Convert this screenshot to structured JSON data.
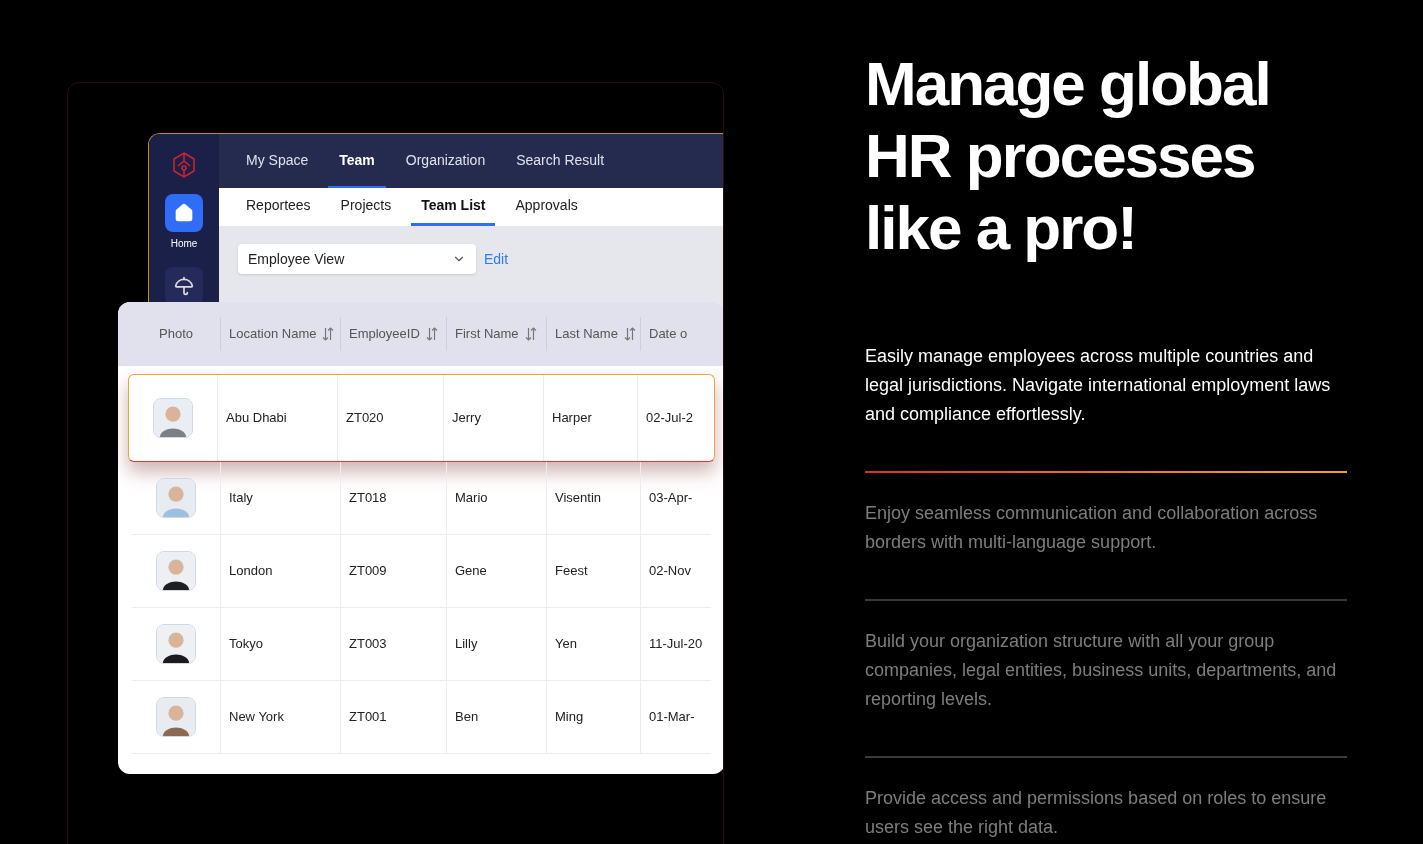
{
  "app": {
    "sidebar": {
      "items": [
        {
          "label": "Home",
          "selected": true
        },
        {
          "selected": false
        }
      ]
    },
    "top_tabs": [
      {
        "label": "My Space",
        "selected": false
      },
      {
        "label": "Team",
        "selected": true
      },
      {
        "label": "Organization",
        "selected": false
      },
      {
        "label": "Search Result",
        "selected": false
      }
    ],
    "sub_tabs": [
      {
        "label": "Reportees",
        "selected": false
      },
      {
        "label": "Projects",
        "selected": false
      },
      {
        "label": "Team List",
        "selected": true
      },
      {
        "label": "Approvals",
        "selected": false
      }
    ],
    "view_select": {
      "value": "Employee View"
    },
    "edit_link": "Edit",
    "table": {
      "photo_column": "Photo",
      "columns": [
        {
          "label": "Location Name",
          "sortable": true
        },
        {
          "label": "EmployeeID",
          "sortable": true
        },
        {
          "label": "First Name",
          "sortable": true
        },
        {
          "label": "Last Name",
          "sortable": true
        },
        {
          "label": "Date o",
          "sortable": false
        }
      ],
      "rows": [
        {
          "selected": true,
          "cells": [
            "Abu Dhabi",
            "ZT020",
            "Jerry",
            "Harper",
            "02-Jul-2"
          ]
        },
        {
          "selected": false,
          "cells": [
            "Italy",
            "ZT018",
            "Mario",
            "Visentin",
            "03-Apr-"
          ]
        },
        {
          "selected": false,
          "cells": [
            "London",
            "ZT009",
            "Gene",
            "Feest",
            "02-Nov"
          ]
        },
        {
          "selected": false,
          "cells": [
            "Tokyo",
            "ZT003",
            "Lilly",
            "Yen",
            "11-Jul-20"
          ]
        },
        {
          "selected": false,
          "cells": [
            "New York",
            "ZT001",
            "Ben",
            "Ming",
            "01-Mar-"
          ]
        }
      ]
    }
  },
  "heading": [
    "Manage global",
    "HR processes",
    "like a pro!"
  ],
  "features": [
    {
      "text": "Easily manage employees across multiple countries and legal jurisdictions. Navigate international employment laws and compliance effortlessly.",
      "selected": true
    },
    {
      "text": "Enjoy seamless communication and collaboration across borders with multi-language support.",
      "selected": false
    },
    {
      "text": "Build your organization structure with all your group companies, legal entities, business units, departments, and reporting levels.",
      "selected": false
    },
    {
      "text": "Provide access and permissions based on roles to ensure users see the right data.",
      "selected": false
    }
  ]
}
